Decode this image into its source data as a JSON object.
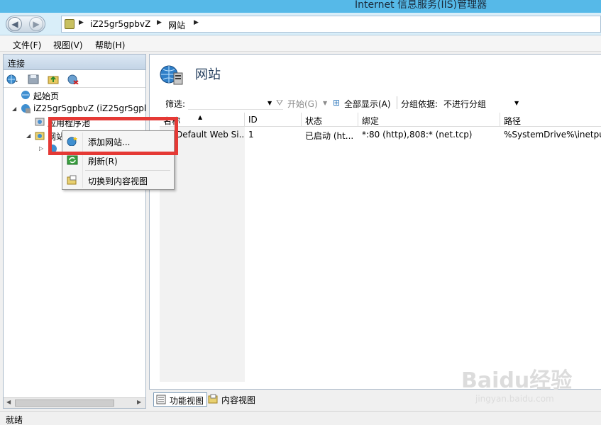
{
  "window": {
    "title": "Internet 信息服务(IIS)管理器"
  },
  "address": {
    "crumbs": [
      "iZ25gr5gpbvZ",
      "网站"
    ]
  },
  "menu": {
    "items": [
      "文件(F)",
      "视图(V)",
      "帮助(H)"
    ]
  },
  "connections": {
    "title": "连接",
    "tree": [
      {
        "label": "起始页"
      },
      {
        "label": "iZ25gr5gpbvZ (iZ25gr5gpb"
      },
      {
        "label": "应用程序池"
      },
      {
        "label": "网站"
      }
    ]
  },
  "main": {
    "title": "网站",
    "filter": {
      "label": "筛选:",
      "go_label": "开始(G)",
      "showall_label": "全部显示(A)",
      "groupby_label": "分组依据:",
      "groupby_value": "不进行分组"
    },
    "columns": [
      "名称",
      "ID",
      "状态",
      "绑定",
      "路径"
    ],
    "rows": [
      {
        "name": "Default Web Si...",
        "id": "1",
        "status": "已启动 (ht...",
        "binding": "*:80 (http),808:* (net.tcp)",
        "path": "%SystemDrive%\\inetpul"
      }
    ]
  },
  "context_menu": {
    "items": [
      "添加网站...",
      "刷新(R)",
      "切换到内容视图"
    ]
  },
  "bottom_tabs": [
    "功能视图",
    "内容视图"
  ],
  "status": {
    "text": "就绪"
  },
  "watermark": {
    "logo": "Baidu经验",
    "url": "jingyan.baidu.com"
  },
  "colors": {
    "titlebar": "#56b9e8",
    "highlight": "#e53935",
    "header": "#1f3a5a"
  }
}
